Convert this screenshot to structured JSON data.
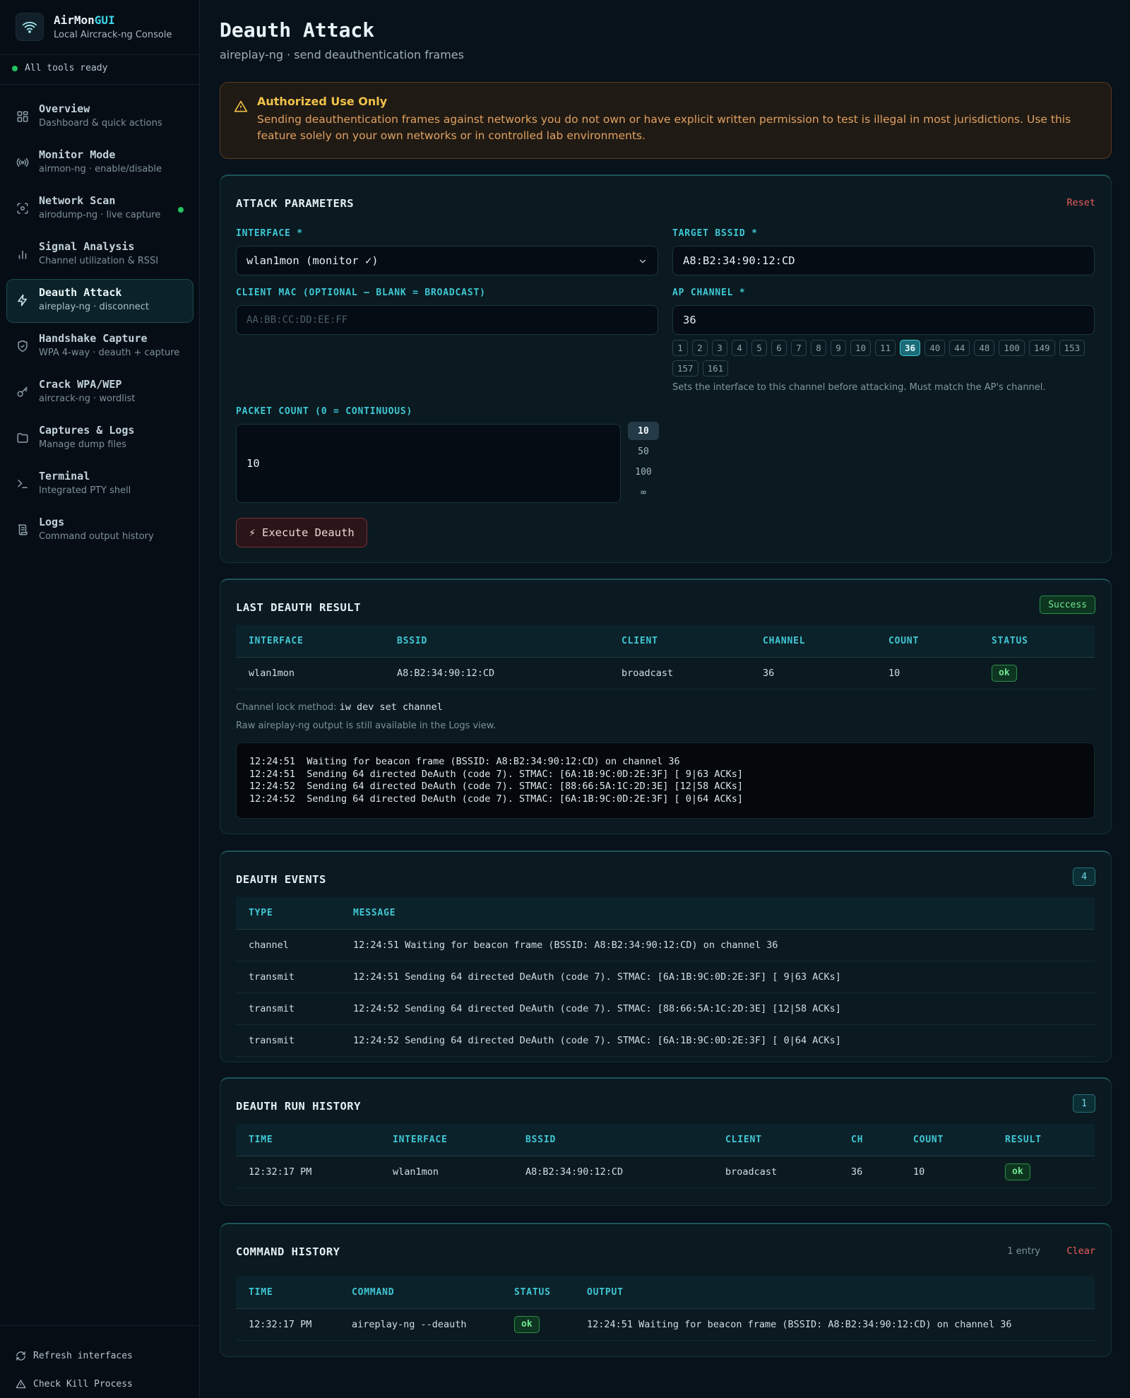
{
  "app": {
    "name_part1": "AirMon",
    "name_part2": "GUI",
    "subtitle": "Local Aircrack-ng Console",
    "status": "All tools ready"
  },
  "nav": [
    {
      "label": "Overview",
      "sub": "Dashboard & quick actions",
      "icon": "grid-icon"
    },
    {
      "label": "Monitor Mode",
      "sub": "airmon-ng · enable/disable",
      "icon": "radio-icon"
    },
    {
      "label": "Network Scan",
      "sub": "airodump-ng · live capture",
      "icon": "scan-icon"
    },
    {
      "label": "Signal Analysis",
      "sub": "Channel utilization & RSSI",
      "icon": "bar-chart-icon"
    },
    {
      "label": "Deauth Attack",
      "sub": "aireplay-ng · disconnect",
      "icon": "zap-icon"
    },
    {
      "label": "Handshake Capture",
      "sub": "WPA 4-way · deauth + capture",
      "icon": "shield-icon"
    },
    {
      "label": "Crack WPA/WEP",
      "sub": "aircrack-ng · wordlist",
      "icon": "key-icon"
    },
    {
      "label": "Captures & Logs",
      "sub": "Manage dump files",
      "icon": "folder-icon"
    },
    {
      "label": "Terminal",
      "sub": "Integrated PTY shell",
      "icon": "terminal-icon"
    },
    {
      "label": "Logs",
      "sub": "Command output history",
      "icon": "scroll-icon"
    }
  ],
  "footer": {
    "refresh": "Refresh interfaces",
    "kill": "Check Kill Process"
  },
  "page": {
    "title": "Deauth Attack",
    "subtitle": "aireplay-ng · send deauthentication frames"
  },
  "warning": {
    "title": "Authorized Use Only",
    "text": "Sending deauthentication frames against networks you do not own or have explicit written permission to test is illegal in most jurisdictions. Use this feature solely on your own networks or in controlled lab environments."
  },
  "params": {
    "title": "ATTACK PARAMETERS",
    "reset": "Reset",
    "interface_label": "INTERFACE *",
    "interface_value": "wlan1mon (monitor ✓)",
    "bssid_label": "TARGET BSSID *",
    "bssid_value": "A8:B2:34:90:12:CD",
    "client_label": "CLIENT MAC (OPTIONAL — BLANK = BROADCAST)",
    "client_placeholder": "AA:BB:CC:DD:EE:FF",
    "channel_label": "AP CHANNEL *",
    "channel_value": "36",
    "channels": [
      "1",
      "2",
      "3",
      "4",
      "5",
      "6",
      "7",
      "8",
      "9",
      "10",
      "11",
      "36",
      "40",
      "44",
      "48",
      "100",
      "149",
      "153",
      "157",
      "161"
    ],
    "selected_channel": "36",
    "channel_hint": "Sets the interface to this channel before attacking. Must match the AP's channel.",
    "count_label": "PACKET COUNT (0 = CONTINUOUS)",
    "count_value": "10",
    "count_options": [
      "10",
      "50",
      "100",
      "∞"
    ],
    "execute": "⚡ Execute Deauth"
  },
  "last_result": {
    "title": "LAST DEAUTH RESULT",
    "badge": "Success",
    "headers": [
      "INTERFACE",
      "BSSID",
      "CLIENT",
      "CHANNEL",
      "COUNT",
      "STATUS"
    ],
    "row": [
      "wlan1mon",
      "A8:B2:34:90:12:CD",
      "broadcast",
      "36",
      "10",
      "ok"
    ],
    "lock_label": "Channel lock method:",
    "lock_value": "iw dev set channel",
    "raw_note": "Raw aireplay-ng output is still available in the Logs view.",
    "console": [
      "12:24:51  Waiting for beacon frame (BSSID: A8:B2:34:90:12:CD) on channel 36",
      "12:24:51  Sending 64 directed DeAuth (code 7). STMAC: [6A:1B:9C:0D:2E:3F] [ 9|63 ACKs]",
      "12:24:52  Sending 64 directed DeAuth (code 7). STMAC: [88:66:5A:1C:2D:3E] [12|58 ACKs]",
      "12:24:52  Sending 64 directed DeAuth (code 7). STMAC: [6A:1B:9C:0D:2E:3F] [ 0|64 ACKs]"
    ]
  },
  "events": {
    "title": "DEAUTH EVENTS",
    "count": "4",
    "headers": [
      "TYPE",
      "MESSAGE"
    ],
    "rows": [
      {
        "type": "channel",
        "message": "12:24:51 Waiting for beacon frame (BSSID: A8:B2:34:90:12:CD) on channel 36"
      },
      {
        "type": "transmit",
        "message": "12:24:51 Sending 64 directed DeAuth (code 7). STMAC: [6A:1B:9C:0D:2E:3F] [ 9|63 ACKs]"
      },
      {
        "type": "transmit",
        "message": "12:24:52 Sending 64 directed DeAuth (code 7). STMAC: [88:66:5A:1C:2D:3E] [12|58 ACKs]"
      },
      {
        "type": "transmit",
        "message": "12:24:52 Sending 64 directed DeAuth (code 7). STMAC: [6A:1B:9C:0D:2E:3F] [ 0|64 ACKs]"
      }
    ]
  },
  "history": {
    "title": "DEAUTH RUN HISTORY",
    "count": "1",
    "headers": [
      "TIME",
      "INTERFACE",
      "BSSID",
      "CLIENT",
      "CH",
      "COUNT",
      "RESULT"
    ],
    "row": [
      "12:32:17 PM",
      "wlan1mon",
      "A8:B2:34:90:12:CD",
      "broadcast",
      "36",
      "10",
      "ok"
    ]
  },
  "commands": {
    "title": "COMMAND HISTORY",
    "entries": "1 entry",
    "clear": "Clear",
    "headers": [
      "TIME",
      "COMMAND",
      "STATUS",
      "OUTPUT"
    ],
    "row": [
      "12:32:17 PM",
      "aireplay-ng --deauth",
      "ok",
      "12:24:51 Waiting for beacon frame (BSSID: A8:B2:34:90:12:CD) on channel 36"
    ]
  },
  "colors": {
    "accent": "#3fc7d4",
    "danger": "#ef5c5c",
    "success": "#22c55e",
    "warning": "#f0c24a"
  }
}
